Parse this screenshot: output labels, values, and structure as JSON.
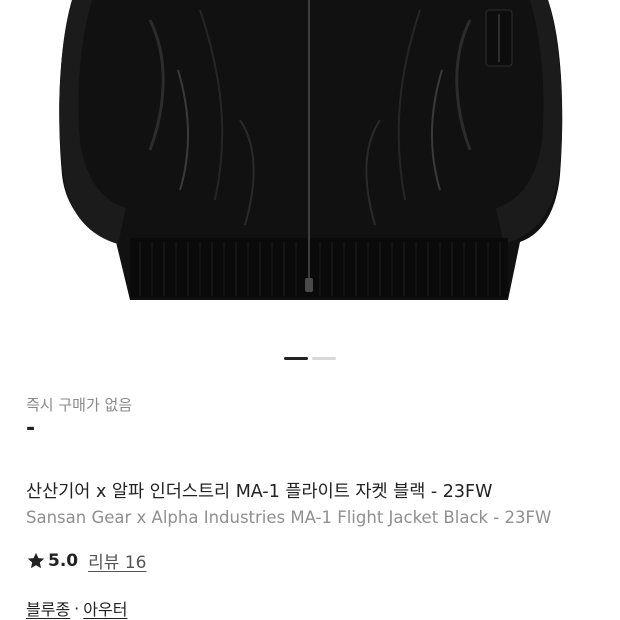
{
  "gallery": {
    "image_alt": "Black MA-1 flight jacket",
    "total_slides": 2,
    "active_slide": 1
  },
  "price": {
    "label": "즉시 구매가 없음",
    "value": "-"
  },
  "product": {
    "title_ko": "산산기어 x 알파 인더스트리 MA-1 플라이트 자켓 블랙 - 23FW",
    "title_en": "Sansan Gear x Alpha Industries MA-1 Flight Jacket Black - 23FW"
  },
  "rating": {
    "icon": "star-icon",
    "value": "5.0",
    "review_label": "리뷰 16"
  },
  "categories": {
    "items": [
      "블루종",
      "아우터"
    ],
    "separator": "·"
  },
  "colors": {
    "text_primary": "#222222",
    "text_secondary": "#8a8a8a",
    "indicator_active": "#222222",
    "indicator_inactive": "#d9d9d9"
  }
}
